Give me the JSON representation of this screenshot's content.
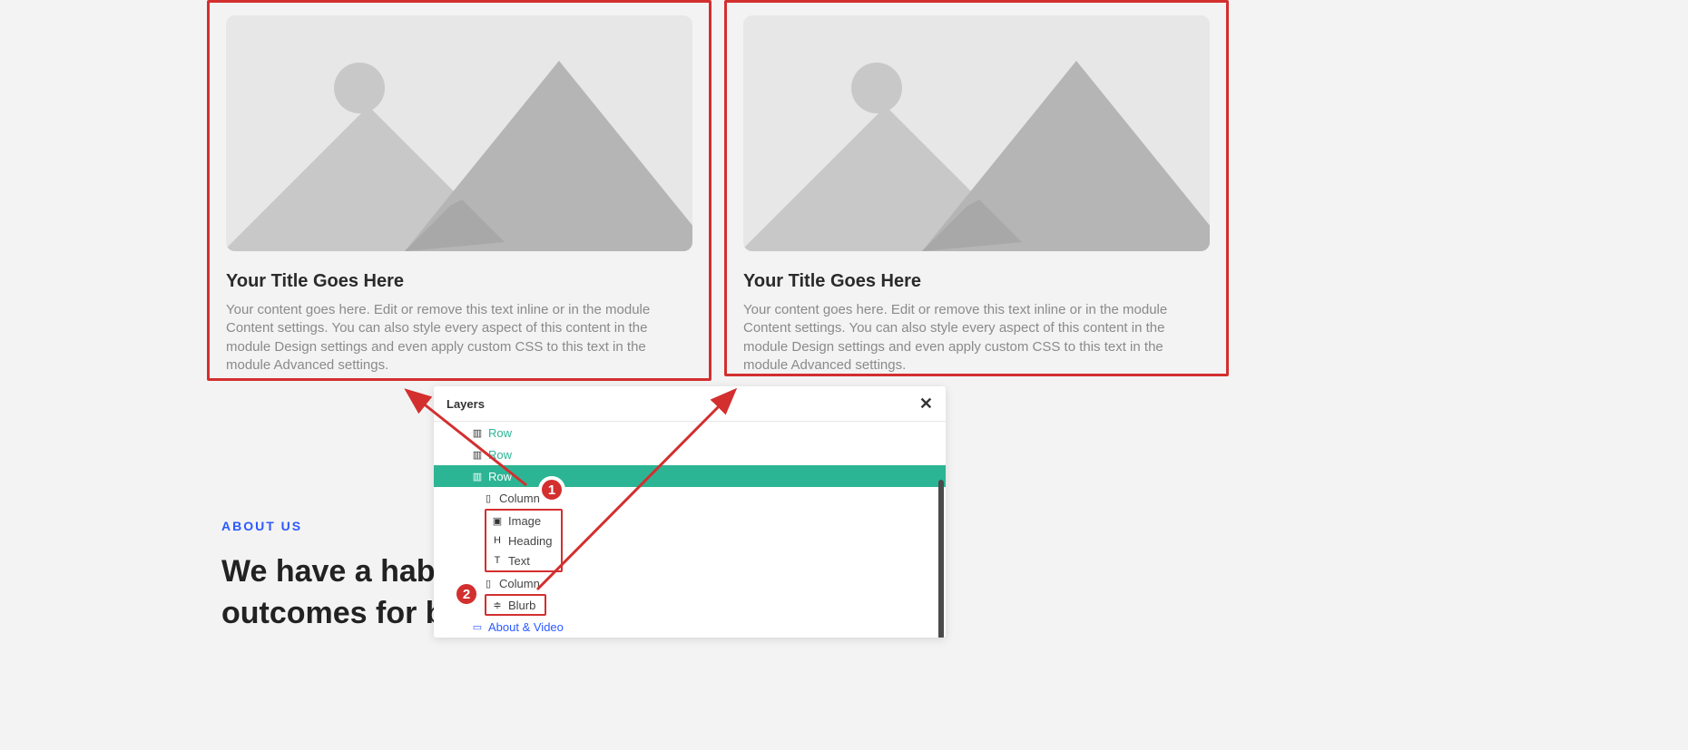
{
  "cards": [
    {
      "title": "Your Title Goes Here",
      "body": "Your content goes here. Edit or remove this text inline or in the module Content settings. You can also style every aspect of this content in the module Design settings and even apply custom CSS to this text in the module Advanced settings."
    },
    {
      "title": "Your Title Goes Here",
      "body": "Your content goes here. Edit or remove this text inline or in the module Content settings. You can also style every aspect of this content in the module Design settings and even apply custom CSS to this text in the module Advanced settings."
    }
  ],
  "about": {
    "label": "ABOUT US",
    "heading_line1": "We have a habit",
    "heading_line2": "outcomes for bu"
  },
  "layers_panel": {
    "title": "Layers",
    "items": [
      {
        "label": "Row",
        "kind": "row-green",
        "indent": 1
      },
      {
        "label": "Row",
        "kind": "row-green",
        "indent": 1
      },
      {
        "label": "Row",
        "kind": "row-selected",
        "indent": 1
      },
      {
        "label": "Column",
        "kind": "column",
        "indent": 2
      },
      {
        "label": "Image",
        "kind": "module",
        "indent": 3,
        "boxed": true,
        "icon": "image"
      },
      {
        "label": "Heading",
        "kind": "module",
        "indent": 3,
        "boxed": true,
        "icon": "heading"
      },
      {
        "label": "Text",
        "kind": "module",
        "indent": 3,
        "boxed": true,
        "icon": "text"
      },
      {
        "label": "Column",
        "kind": "column",
        "indent": 2
      },
      {
        "label": "Blurb",
        "kind": "module",
        "indent": 3,
        "boxed": true,
        "icon": "blurb"
      },
      {
        "label": "About & Video",
        "kind": "blue",
        "indent": 1
      }
    ]
  },
  "badges": {
    "one": "1",
    "two": "2"
  }
}
